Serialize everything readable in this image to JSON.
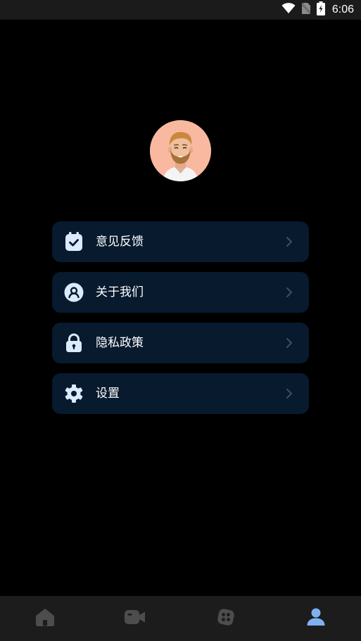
{
  "status_bar": {
    "time": "6:06",
    "icons": [
      "wifi-icon",
      "no-sim-icon",
      "battery-charging-icon"
    ]
  },
  "profile": {
    "avatar": "avatar-icon"
  },
  "menu": {
    "items": [
      {
        "label": "意见反馈",
        "icon": "feedback-icon"
      },
      {
        "label": "关于我们",
        "icon": "about-us-icon"
      },
      {
        "label": "隐私政策",
        "icon": "lock-icon"
      },
      {
        "label": "设置",
        "icon": "gear-icon"
      }
    ]
  },
  "tab_bar": {
    "tabs": [
      {
        "icon": "home-icon",
        "active": false
      },
      {
        "icon": "video-icon",
        "active": false
      },
      {
        "icon": "apps-icon",
        "active": false
      },
      {
        "icon": "profile-icon",
        "active": true
      }
    ]
  },
  "colors": {
    "background": "#000000",
    "card": "#071a2e",
    "tab_bar": "#1c1c1c",
    "tab_inactive": "#4d4d4d",
    "tab_active": "#7fb2f0",
    "icon": "#dbeaff"
  }
}
